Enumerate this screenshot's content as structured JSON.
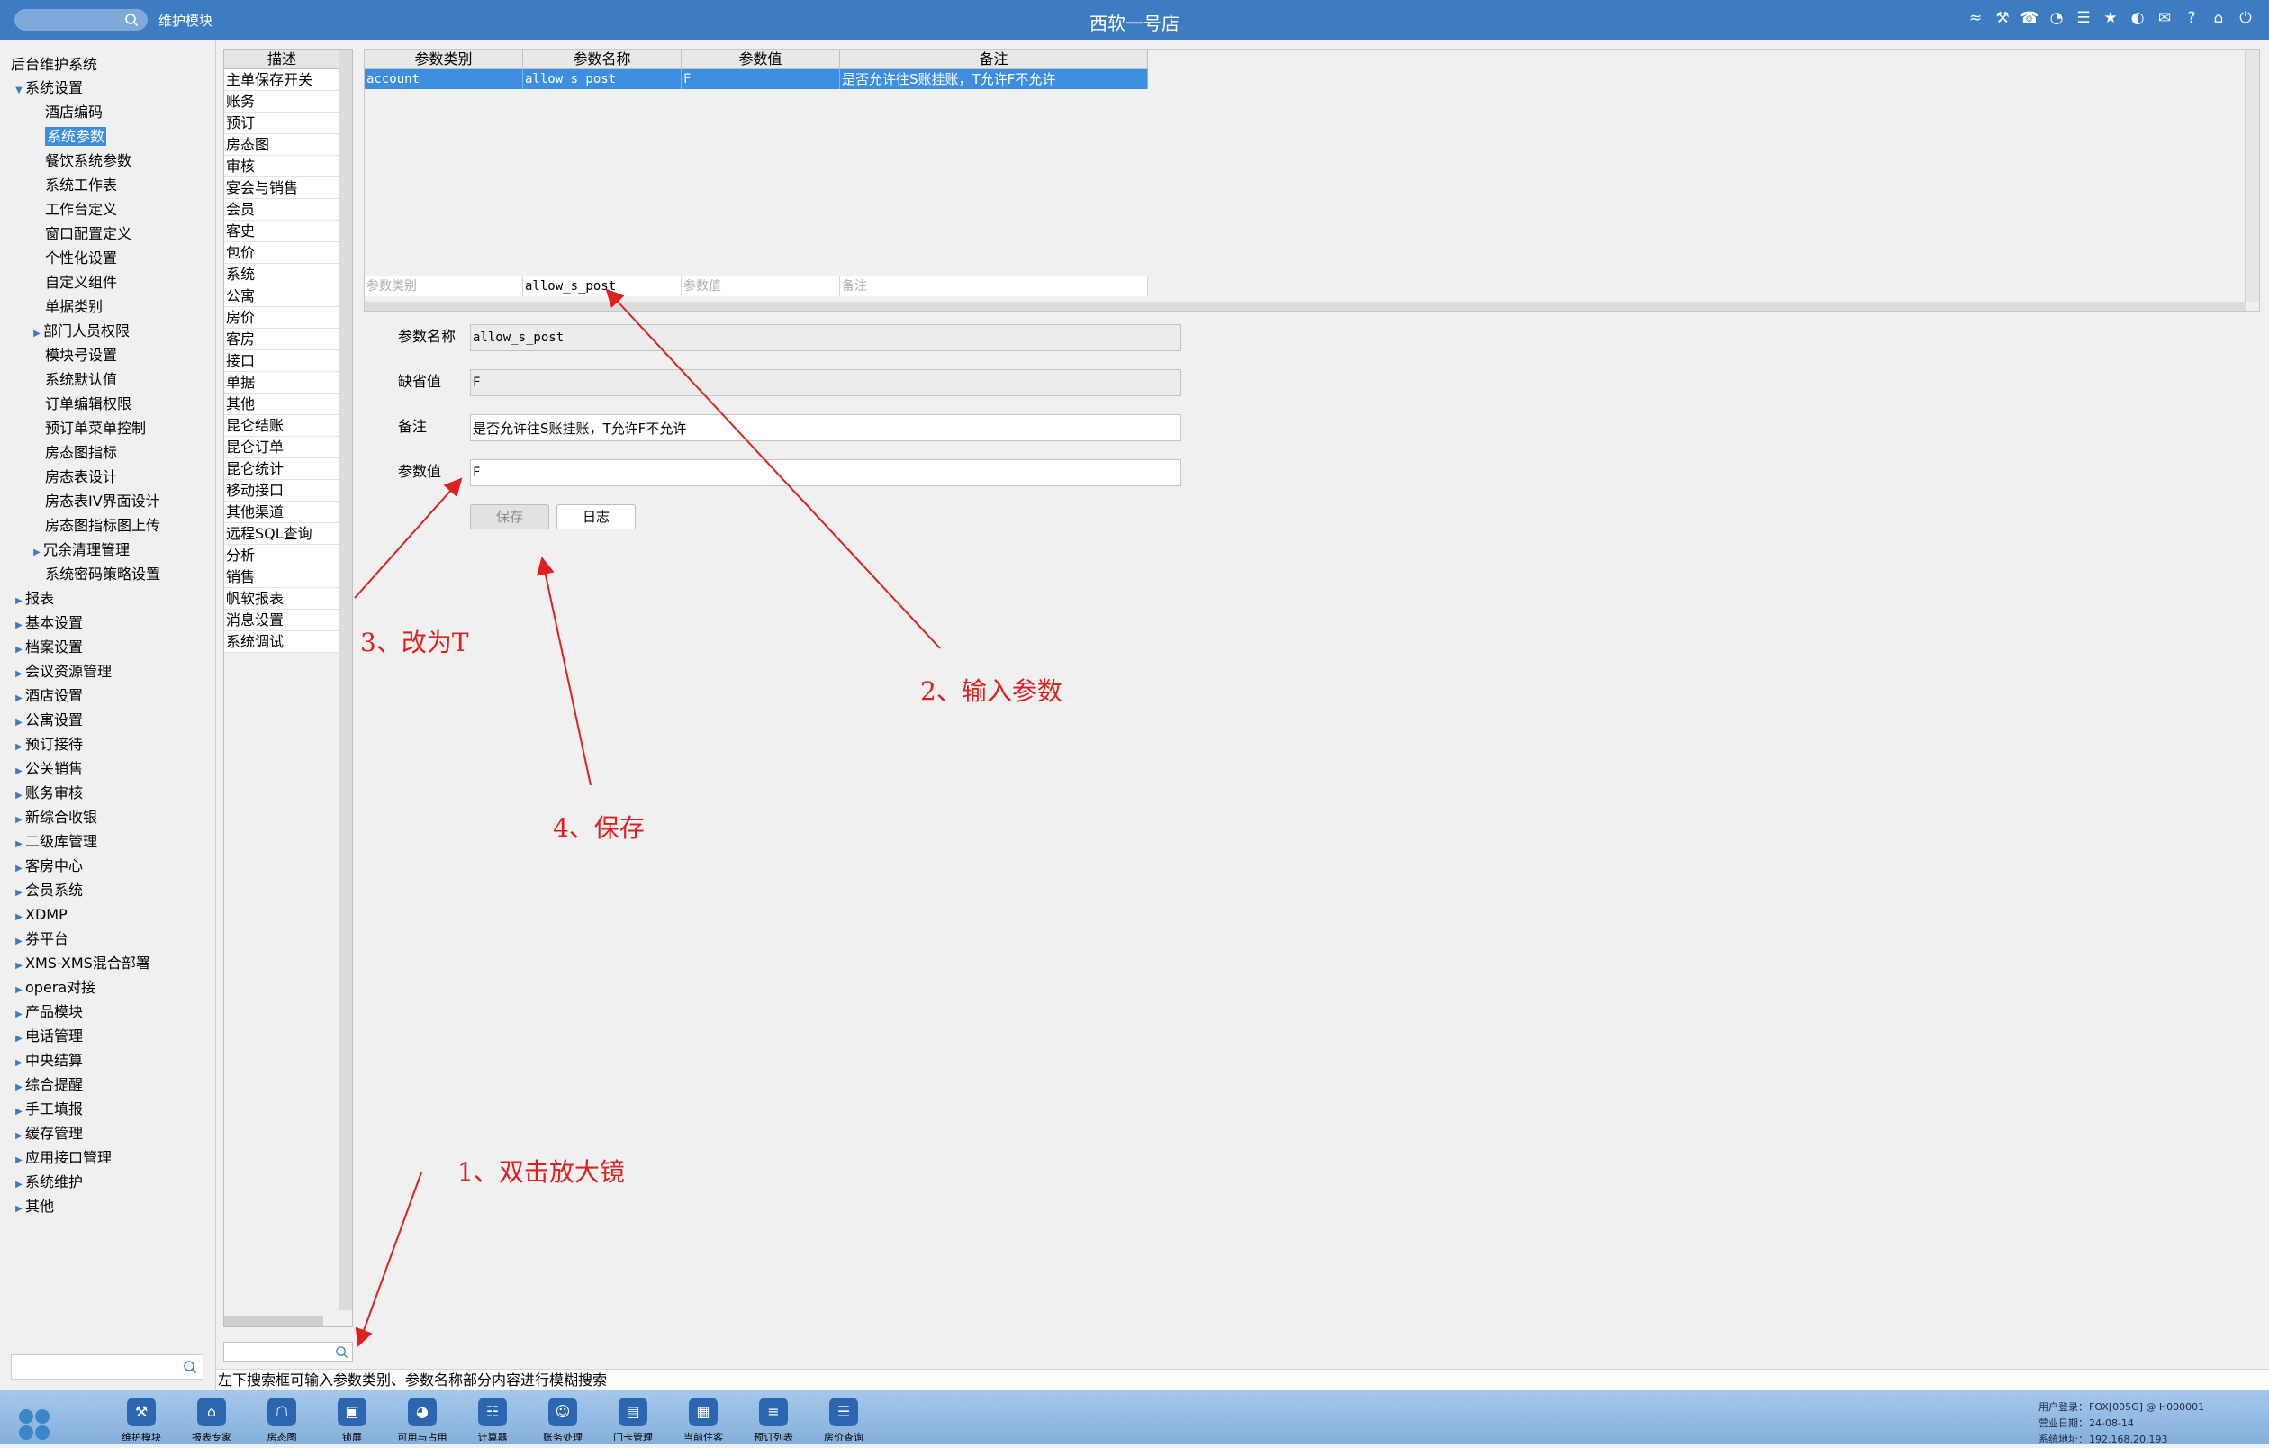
{
  "topbar": {
    "module_label": "维护模块",
    "title": "西软一号店",
    "icons": [
      "wifi-icon",
      "tools-icon",
      "phone-icon",
      "palette-icon",
      "menu-icon",
      "star-icon",
      "theme-icon",
      "mail-icon",
      "help-icon",
      "home-icon",
      "power-icon"
    ]
  },
  "nav": {
    "root": "后台维护系统",
    "items": [
      {
        "label": "系统设置",
        "level": 1,
        "expanded": true
      },
      {
        "label": "酒店编码",
        "level": 2
      },
      {
        "label": "系统参数",
        "level": 2,
        "selected": true
      },
      {
        "label": "餐饮系统参数",
        "level": 2
      },
      {
        "label": "系统工作表",
        "level": 2
      },
      {
        "label": "工作台定义",
        "level": 2
      },
      {
        "label": "窗口配置定义",
        "level": 2
      },
      {
        "label": "个性化设置",
        "level": 2
      },
      {
        "label": "自定义组件",
        "level": 2
      },
      {
        "label": "单据类别",
        "level": 2
      },
      {
        "label": "部门人员权限",
        "level": 2,
        "expandable": true
      },
      {
        "label": "模块号设置",
        "level": 2
      },
      {
        "label": "系统默认值",
        "level": 2
      },
      {
        "label": "订单编辑权限",
        "level": 2
      },
      {
        "label": "预订单菜单控制",
        "level": 2
      },
      {
        "label": "房态图指标",
        "level": 2
      },
      {
        "label": "房态表设计",
        "level": 2
      },
      {
        "label": "房态表IV界面设计",
        "level": 2
      },
      {
        "label": "房态图指标图上传",
        "level": 2
      },
      {
        "label": "冗余清理管理",
        "level": 2,
        "expandable": true
      },
      {
        "label": "系统密码策略设置",
        "level": 2
      },
      {
        "label": "报表",
        "level": 1
      },
      {
        "label": "基本设置",
        "level": 1
      },
      {
        "label": "档案设置",
        "level": 1
      },
      {
        "label": "会议资源管理",
        "level": 1
      },
      {
        "label": "酒店设置",
        "level": 1
      },
      {
        "label": "公寓设置",
        "level": 1
      },
      {
        "label": "预订接待",
        "level": 1
      },
      {
        "label": "公关销售",
        "level": 1
      },
      {
        "label": "账务审核",
        "level": 1
      },
      {
        "label": "新综合收银",
        "level": 1
      },
      {
        "label": "二级库管理",
        "level": 1
      },
      {
        "label": "客房中心",
        "level": 1
      },
      {
        "label": "会员系统",
        "level": 1
      },
      {
        "label": "XDMP",
        "level": 1
      },
      {
        "label": "券平台",
        "level": 1
      },
      {
        "label": "XMS-XMS混合部署",
        "level": 1
      },
      {
        "label": "opera对接",
        "level": 1
      },
      {
        "label": "产品模块",
        "level": 1
      },
      {
        "label": "电话管理",
        "level": 1
      },
      {
        "label": "中央结算",
        "level": 1
      },
      {
        "label": "综合提醒",
        "level": 1
      },
      {
        "label": "手工填报",
        "level": 1
      },
      {
        "label": "缓存管理",
        "level": 1
      },
      {
        "label": "应用接口管理",
        "level": 1
      },
      {
        "label": "系统维护",
        "level": 1
      },
      {
        "label": "其他",
        "level": 1
      }
    ]
  },
  "categories": {
    "header": "描述",
    "items": [
      "主单保存开关",
      "账务",
      "预订",
      "房态图",
      "审核",
      "宴会与销售",
      "会员",
      "客史",
      "包价",
      "系统",
      "公寓",
      "房价",
      "客房",
      "接口",
      "单据",
      "其他",
      "昆仑结账",
      "昆仑订单",
      "昆仑统计",
      "移动接口",
      "其他渠道",
      "远程SQL查询",
      "分析",
      "销售",
      "帆软报表",
      "消息设置",
      "系统调试"
    ]
  },
  "grid": {
    "headers": [
      "参数类别",
      "参数名称",
      "参数值",
      "备注"
    ],
    "row": [
      "account",
      "allow_s_post",
      "F",
      "是否允许往S账挂账，T允许F不允许"
    ],
    "filter_placeholders": [
      "参数类别",
      "",
      "参数值",
      "备注"
    ],
    "filter_values": [
      "",
      "allow_s_post",
      "",
      ""
    ]
  },
  "form": {
    "name_label": "参数名称",
    "name_value": "allow_s_post",
    "default_label": "缺省值",
    "default_value": "F",
    "remark_label": "备注",
    "remark_value": "是否允许往S账挂账，T允许F不允许",
    "value_label": "参数值",
    "value_value": "F",
    "save_button": "保存",
    "log_button": "日志"
  },
  "status_hint": "左下搜索框可输入参数类别、参数名称部分内容进行模糊搜索",
  "dock": {
    "apps": [
      {
        "label": "维护模块",
        "icon": "wrench-icon"
      },
      {
        "label": "报表专家",
        "icon": "graduation-icon"
      },
      {
        "label": "房态图",
        "icon": "bank-icon"
      },
      {
        "label": "锁屏",
        "icon": "lock-icon"
      },
      {
        "label": "可用与占用",
        "icon": "pie-icon"
      },
      {
        "label": "计算器",
        "icon": "calculator-icon"
      },
      {
        "label": "账务处理",
        "icon": "person-money-icon"
      },
      {
        "label": "门卡管理",
        "icon": "card-icon"
      },
      {
        "label": "当前住客",
        "icon": "id-card-icon"
      },
      {
        "label": "预订列表",
        "icon": "list-doc-icon"
      },
      {
        "label": "房价查询",
        "icon": "price-doc-icon"
      }
    ],
    "info": [
      {
        "k": "用户登录：",
        "v": "FOX[005G] @ H000001"
      },
      {
        "k": "营业日期：",
        "v": "24-08-14"
      },
      {
        "k": "系统地址：",
        "v": "192.168.20.193"
      }
    ]
  },
  "annotations": {
    "step1": "1、双击放大镜",
    "step2": "2、输入参数",
    "step3": "3、改为T",
    "step4": "4、保存"
  },
  "colors": {
    "topbar": "#3d7cc3",
    "selection": "#3d8ee0",
    "annotation": "#e02020",
    "dock_tile": "#2d66b0"
  }
}
